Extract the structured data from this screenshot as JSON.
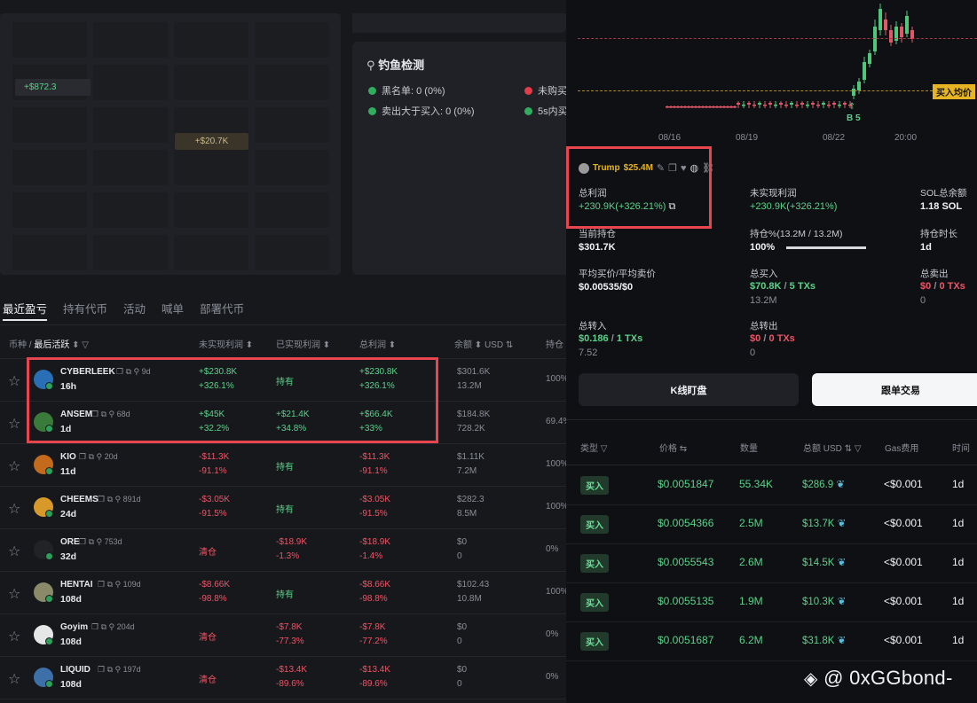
{
  "heatmap": {
    "label_a": "+$872.3",
    "label_b": "+$20.7K"
  },
  "phishing": {
    "title": "钓鱼检测",
    "items": [
      {
        "label": "黑名单: 0 (0%)",
        "color": "#2fae5e"
      },
      {
        "label": "未购买",
        "color": "#e23b4a"
      },
      {
        "label": "卖出大于买入: 0 (0%)",
        "color": "#2fae5e"
      },
      {
        "label": "5s内买",
        "color": "#2fae5e"
      }
    ]
  },
  "tabs": [
    "最近盈亏",
    "持有代币",
    "活动",
    "喊单",
    "部署代币"
  ],
  "table_header": {
    "token": "币种 / ",
    "sort": "最后活跃",
    "unrealized": "未实现利润",
    "realized": "已实现利润",
    "total": "总利润",
    "balance": "余额",
    "usd": "USD",
    "position": "持仓"
  },
  "rows": [
    {
      "name": "CYBERLEEK",
      "age_small": "9d",
      "age": "16h",
      "u1": "+$230.8K",
      "u2": "+326.1%",
      "r1": "持有",
      "r2": "",
      "t1": "+$230.8K",
      "t2": "+326.1%",
      "b1": "$301.6K",
      "b2": "13.2M",
      "p": "100%",
      "icon": "#2a6fb5"
    },
    {
      "name": "ANSEM",
      "age_small": "68d",
      "age": "1d",
      "u1": "+$45K",
      "u2": "+32.2%",
      "r1": "+$21.4K",
      "r2": "+34.8%",
      "t1": "+$66.4K",
      "t2": "+33%",
      "b1": "$184.8K",
      "b2": "728.2K",
      "p": "69.4%",
      "icon": "#3a7a3a"
    },
    {
      "name": "KIO",
      "age_small": "20d",
      "age": "11d",
      "u1": "-$11.3K",
      "u2": "-91.1%",
      "r1": "持有",
      "r2": "",
      "t1": "-$11.3K",
      "t2": "-91.1%",
      "b1": "$1.11K",
      "b2": "7.2M",
      "p": "100%",
      "icon": "#c46a1c"
    },
    {
      "name": "CHEEMS",
      "age_small": "891d",
      "age": "24d",
      "u1": "-$3.05K",
      "u2": "-91.5%",
      "r1": "持有",
      "r2": "",
      "t1": "-$3.05K",
      "t2": "-91.5%",
      "b1": "$282.3",
      "b2": "8.5M",
      "p": "100%",
      "icon": "#d79a2a"
    },
    {
      "name": "ORE",
      "age_small": "753d",
      "age": "32d",
      "u1": "清仓",
      "u2": "",
      "r1": "-$18.9K",
      "r2": "-1.3%",
      "t1": "-$18.9K",
      "t2": "-1.4%",
      "b1": "$0",
      "b2": "0",
      "p": "0%",
      "icon": "#222327"
    },
    {
      "name": "HENTAI",
      "age_small": "109d",
      "age": "108d",
      "u1": "-$8.66K",
      "u2": "-98.8%",
      "r1": "持有",
      "r2": "",
      "t1": "-$8.66K",
      "t2": "-98.8%",
      "b1": "$102.43",
      "b2": "10.8M",
      "p": "100%",
      "icon": "#8a8a6a"
    },
    {
      "name": "Goyim",
      "age_small": "204d",
      "age": "108d",
      "u1": "清仓",
      "u2": "",
      "r1": "-$7.8K",
      "r2": "-77.3%",
      "t1": "-$7.8K",
      "t2": "-77.2%",
      "b1": "$0",
      "b2": "0",
      "p": "0%",
      "icon": "#e6e6e6"
    },
    {
      "name": "LIQUID",
      "age_small": "197d",
      "age": "108d",
      "u1": "清仓",
      "u2": "",
      "r1": "-$13.4K",
      "r2": "-89.6%",
      "t1": "-$13.4K",
      "t2": "-89.6%",
      "b1": "$0",
      "b2": "0",
      "p": "0%",
      "icon": "#3d6fa8"
    }
  ],
  "chart": {
    "x_ticks": [
      "08/16",
      "08/19",
      "08/22",
      "20:00"
    ],
    "buy_avg_label": "买入均价",
    "marker": "B 5"
  },
  "token_info": {
    "name": "Trump",
    "mcap": "$25.4M",
    "total_profit_label": "总利润",
    "total_profit": "+230.9K(+326.21%)",
    "unrealized_label": "未实现利润",
    "unrealized": "+230.9K(+326.21%)",
    "sol_label": "SOL总余额",
    "sol": "1.18 SOL",
    "holding_label": "当前持仓",
    "holding": "$301.7K",
    "position_label": "持仓%(13.2M / 13.2M)",
    "position": "100%",
    "position_fraction": 1.0,
    "duration_label": "持仓时长",
    "duration": "1d",
    "avg_label": "平均买价/平均卖价",
    "avg": "$0.00535/$0",
    "buy_label": "总买入",
    "buy_usd": "$70.8K",
    "buy_txs": "5 TXs",
    "buy_sub": "13.2M",
    "sell_label": "总卖出",
    "sell_usd": "$0",
    "sell_txs": "0 TXs",
    "sell_sub": "0",
    "in_label": "总转入",
    "in_usd": "$0.186",
    "in_txs": "1 TXs",
    "in_sub": "7.52",
    "out_label": "总转出",
    "out_usd": "$0",
    "out_txs": "0 TXs",
    "out_sub": "0",
    "sep": "/"
  },
  "buttons": {
    "kline": "K线盯盘",
    "copy": "跟单交易"
  },
  "tx_header": {
    "type": "类型",
    "price": "价格",
    "qty": "数量",
    "total": "总额",
    "usd": "USD",
    "gas": "Gas费用",
    "time": "时间"
  },
  "transactions": [
    {
      "type": "买入",
      "price": "$0.0051847",
      "qty": "55.34K",
      "total": "$286.9",
      "gas": "<$0.001",
      "time": "1d"
    },
    {
      "type": "买入",
      "price": "$0.0054366",
      "qty": "2.5M",
      "total": "$13.7K",
      "gas": "<$0.001",
      "time": "1d"
    },
    {
      "type": "买入",
      "price": "$0.0055543",
      "qty": "2.6M",
      "total": "$14.5K",
      "gas": "<$0.001",
      "time": "1d"
    },
    {
      "type": "买入",
      "price": "$0.0055135",
      "qty": "1.9M",
      "total": "$10.3K",
      "gas": "<$0.001",
      "time": "1d"
    },
    {
      "type": "买入",
      "price": "$0.0051687",
      "qty": "6.2M",
      "total": "$31.8K",
      "gas": "<$0.001",
      "time": "1d"
    }
  ],
  "watermark": "@ 0xGGbond-",
  "colors": {
    "green": "#5cd18a",
    "red": "#ee5566",
    "highlight": "#e8464e",
    "gold": "#f0b90b"
  }
}
